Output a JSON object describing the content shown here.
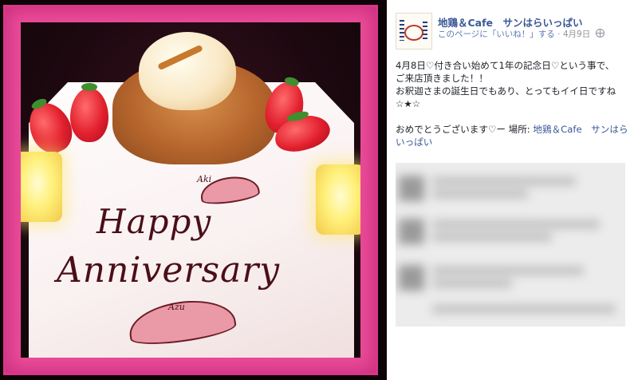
{
  "post": {
    "page_name": "地鶏＆Cafe　サンはらいっぱい",
    "like_link": "このページに「いいね！」する",
    "separator": "·",
    "date": "4月9日",
    "body_lines": [
      "4月8日♡付き合い始めて1年の記念日♡という事で、",
      "ご来店頂きました！！",
      "お釈迦さまの誕生日でもあり、とってもイイ日ですね",
      "☆★☆"
    ],
    "footer_text": "おめでとうございます♡ー 場所: ",
    "place": "地鶏＆Cafe　サンはらいっぱい"
  },
  "photo": {
    "line1": "Happy",
    "line2": "Anniversary",
    "initial_top": "Aki",
    "initial_bottom": "Azu"
  },
  "colors": {
    "frame": "#ea4c99",
    "link": "#3b5998",
    "text": "#1d2129"
  }
}
